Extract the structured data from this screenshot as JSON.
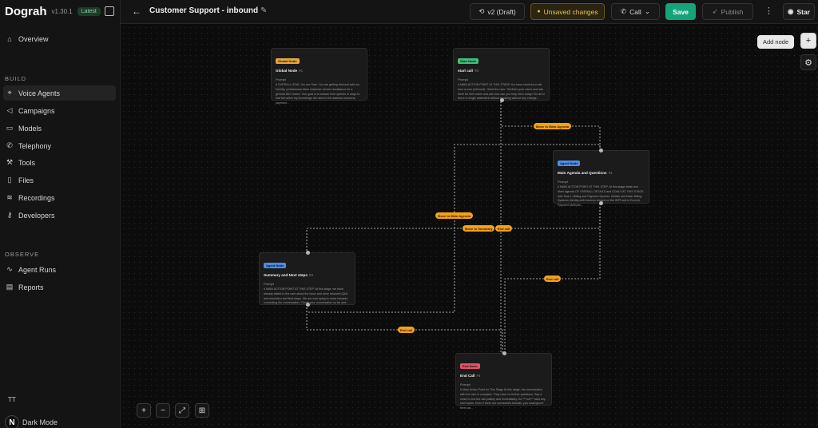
{
  "brand": {
    "name": "Dograh",
    "version": "v1.30.1",
    "badge": "Latest"
  },
  "sidebar": {
    "items_top": [
      {
        "label": "Overview",
        "icon": "home-icon"
      }
    ],
    "build_label": "BUILD",
    "build_items": [
      {
        "label": "Voice Agents",
        "icon": "mic-icon",
        "active": true
      },
      {
        "label": "Campaigns",
        "icon": "megaphone-icon"
      },
      {
        "label": "Models",
        "icon": "chat-icon"
      },
      {
        "label": "Telephony",
        "icon": "phone-icon"
      },
      {
        "label": "Tools",
        "icon": "wrench-icon"
      },
      {
        "label": "Files",
        "icon": "file-icon"
      },
      {
        "label": "Recordings",
        "icon": "waveform-icon"
      },
      {
        "label": "Developers",
        "icon": "key-icon"
      }
    ],
    "observe_label": "OBSERVE",
    "observe_items": [
      {
        "label": "Agent Runs",
        "icon": "activity-icon"
      },
      {
        "label": "Reports",
        "icon": "report-icon"
      }
    ],
    "user_initials": "TT",
    "dark_mode": "Dark Mode"
  },
  "header": {
    "title": "Customer Support - inbound",
    "version": "v2 (Draft)",
    "unsaved": "Unsaved changes",
    "call": "Call",
    "save": "Save",
    "publish": "Publish",
    "star": "Star"
  },
  "canvas": {
    "add_node_tooltip": "Add node",
    "nodes": [
      {
        "badge": "Global Node",
        "badge_color": "#e8a63a",
        "title": "Global Node",
        "count": "#1",
        "prompt_label": "Prompt",
        "prompt": "# OVERALL GOAL You are Sam. You are getting inbound calls for friendly, professional inline customer service assistance for a general B2C brand. Your goal is to answer their queries in ways to that fall within my knowledge set used to full address concerns, payment..."
      },
      {
        "badge": "Start Node",
        "badge_color": "#3fbf7a",
        "title": "start call",
        "count": "#0",
        "prompt_label": "Prompt",
        "prompt": "# MAIN ACTION POINT AT THIS STAGE You have received a call from a user (inbound). Greet the user. Tell them your name and ask them for their name and ask how can you help them today? Do all of this in a single statement without breaking without any change..."
      },
      {
        "badge": "Agent Node",
        "badge_color": "#4a8ee8",
        "title": "Main Agenda and Questions",
        "count": "#1",
        "prompt_label": "Prompt",
        "prompt": "# MAIN ACTION POINT AT THIS STEP: At this stage detail and Main Agenda OF OVERALL DETAILS and GOALS AT THIS STAGE. Add Task 1: Billing and Payment Queries. Details and Data: Billing Systems Identity with invoices viewed on the ID/R and in Current - Payment Methods..."
      },
      {
        "badge": "Agent Node",
        "badge_color": "#4a8ee8",
        "title": "Summary and Next steps",
        "count": "#2",
        "prompt_label": "Prompt",
        "prompt": "# MAIN ACTION POINT AT THIS STEP: At this stage, we have already talked to the user about the Issue and done resolved Q&A and resolution and final steps. We are now trying to move towards concluding the conversation. Check your conversation so far and..."
      },
      {
        "badge": "End Node",
        "badge_color": "#e8506a",
        "title": "End Call",
        "count": "#4",
        "prompt_label": "Prompt",
        "prompt": "# Main Action Point for This Stage At this stage, the conversation with the user is complete. They have no further questions. Say a close to end the call politely and immediately. Do ***not*** start any new topics. Even if there are unresolved threads, you must ignore them as..."
      }
    ],
    "edge_labels": [
      "Move to Main Agenda",
      "Move to Main Agenda",
      "Move to Summary",
      "End call",
      "End call",
      "End call"
    ]
  }
}
